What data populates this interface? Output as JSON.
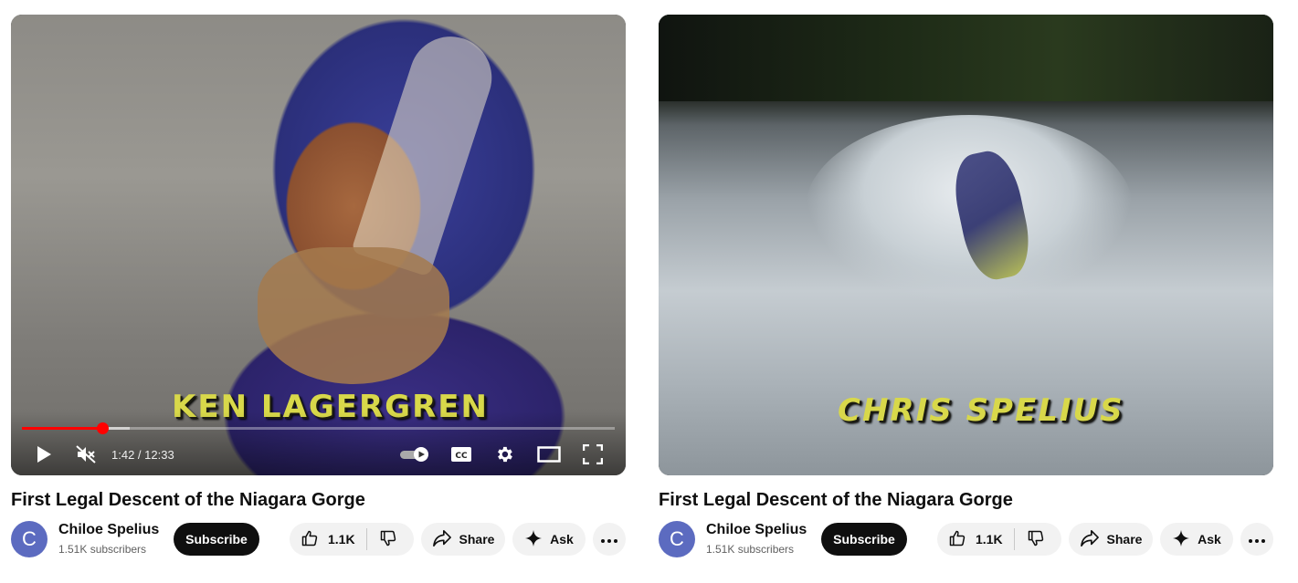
{
  "left": {
    "overlay_caption": "KEN LAGERGREN",
    "player": {
      "time_display": "1:42 / 12:33",
      "progress_played_fraction": 0.136,
      "progress_buffered_fraction": 0.182,
      "icons": {
        "play": "play-icon",
        "mute": "muted-speaker-icon",
        "autoplay": "autoplay-toggle-icon",
        "captions": "cc-icon",
        "settings": "gear-icon",
        "theater": "theater-mode-icon",
        "fullscreen": "fullscreen-icon"
      }
    },
    "title": "First Legal Descent of the Niagara Gorge",
    "channel": {
      "avatar_letter": "C",
      "name": "Chiloe Spelius",
      "subscribers": "1.51K subscribers"
    },
    "actions": {
      "subscribe_label": "Subscribe",
      "like_count": "1.1K",
      "share_label": "Share",
      "ask_label": "Ask",
      "more_label": "⋯"
    }
  },
  "right": {
    "overlay_caption": "CHRIS SPELIUS",
    "title": "First Legal Descent of the Niagara Gorge",
    "channel": {
      "avatar_letter": "C",
      "name": "Chiloe Spelius",
      "subscribers": "1.51K subscribers"
    },
    "actions": {
      "subscribe_label": "Subscribe",
      "like_count": "1.1K",
      "share_label": "Share",
      "ask_label": "Ask",
      "more_label": "⋯"
    }
  },
  "colors": {
    "progress_played": "#ff0000",
    "subscribe_bg": "#0f0f0f",
    "pill_bg": "#f2f2f2",
    "avatar_bg": "#5c6bc0",
    "caption_text": "#d8d84a"
  }
}
